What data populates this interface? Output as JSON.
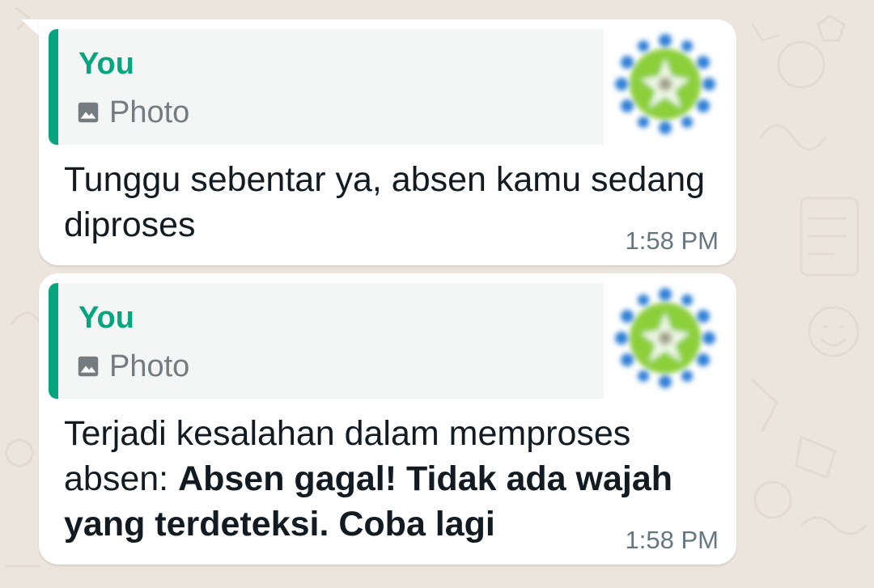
{
  "theme": {
    "accent": "#06a57d",
    "bubble": "#ffffff",
    "quote_bg": "#f4f5f5",
    "text": "#111b21",
    "meta": "#667781",
    "wallpaper": "#ece5dd"
  },
  "messages": [
    {
      "quote": {
        "author": "You",
        "type_icon": "photo-icon",
        "type_label": "Photo",
        "thumbnail": "green-blue-mandala-thumbnail"
      },
      "text": "Tunggu sebentar ya, absen kamu sedang diproses",
      "time": "1:58 PM"
    },
    {
      "quote": {
        "author": "You",
        "type_icon": "photo-icon",
        "type_label": "Photo",
        "thumbnail": "green-blue-mandala-thumbnail"
      },
      "text_plain": "Terjadi kesalahan dalam memproses absen: ",
      "text_bold": "Absen gagal! Tidak ada wajah yang terdeteksi. Coba lagi",
      "time": "1:58 PM"
    }
  ]
}
